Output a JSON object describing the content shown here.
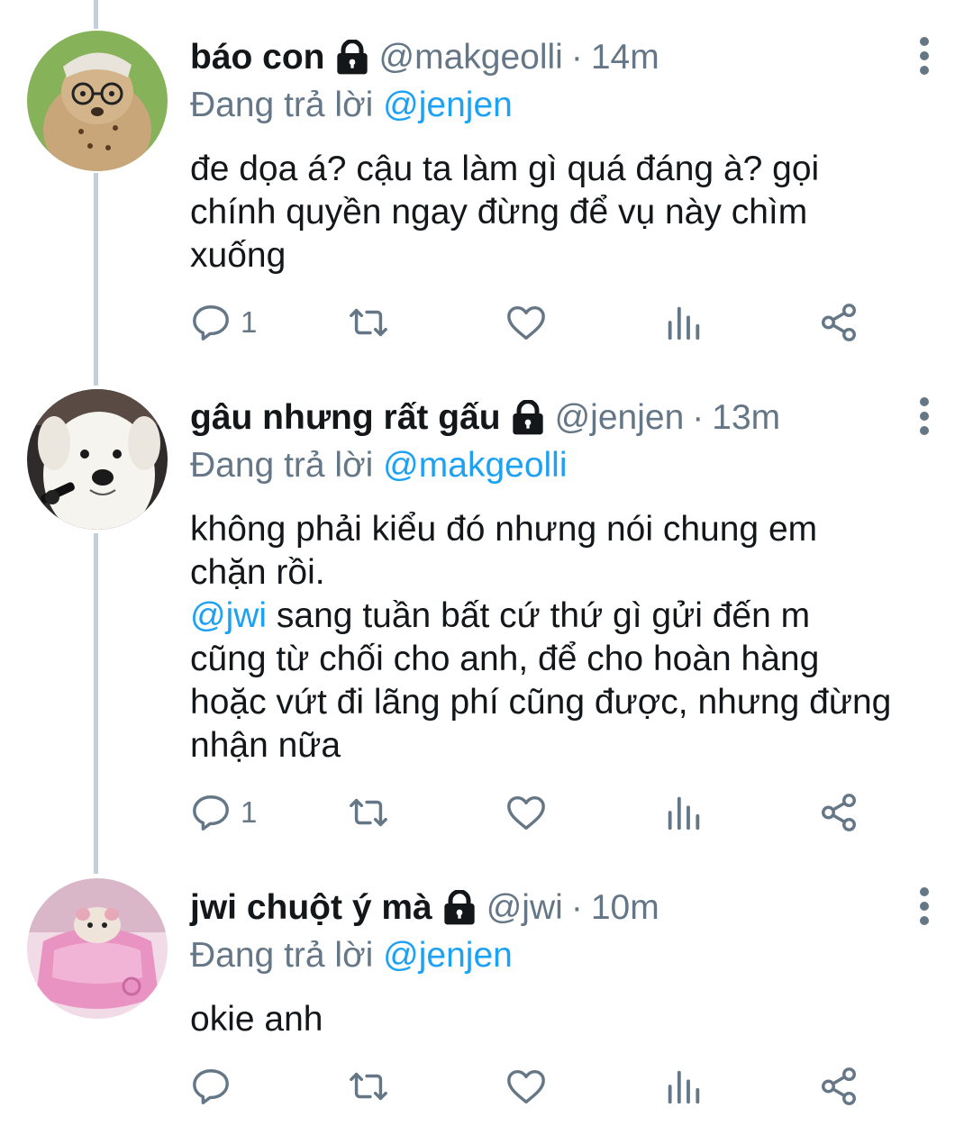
{
  "tweets": [
    {
      "display_name": "báo con",
      "handle": "@makgeolli",
      "separator": "·",
      "time": "14m",
      "replying_prefix": "Đang trả lời",
      "replying_to": "@jenjen",
      "text_lines": [
        "đe dọa á? cậu ta làm gì quá đáng à? gọi",
        "chính quyền ngay đừng để vụ này chìm",
        "xuống"
      ],
      "reply_count": "1",
      "avatar_colors": [
        "#7aa84a",
        "#c9a57a"
      ]
    },
    {
      "display_name": "gâu nhưng rất gấu",
      "handle": "@jenjen",
      "separator": "·",
      "time": "13m",
      "replying_prefix": "Đang trả lời",
      "replying_to": "@makgeolli",
      "text_line1": "không phải kiểu đó nhưng nói chung em",
      "text_line2": "chặn rồi.",
      "mention": "@jwi",
      "text_line3_rest": " sang tuần bất cứ thứ gì gửi đến m",
      "text_line4": "cũng từ chối cho anh, để cho hoàn hàng",
      "text_line5": "hoặc vứt đi lãng phí cũng được, nhưng đừng",
      "text_line6": "nhận nữa",
      "reply_count": "1",
      "avatar_colors": [
        "#3a3a3a",
        "#f4f2ee"
      ]
    },
    {
      "display_name": "jwi chuột ý mà",
      "handle": "@jwi",
      "separator": "·",
      "time": "10m",
      "replying_prefix": "Đang trả lời",
      "replying_to": "@jenjen",
      "text": "okie anh",
      "reply_count": "",
      "avatar_colors": [
        "#e9a6c8",
        "#f3d9e6"
      ]
    }
  ],
  "colors": {
    "accent": "#1da1f2",
    "secondary_text": "#657786",
    "icon": "#657786",
    "thread_line": "#c4cfd6"
  },
  "icons": {
    "reply": "reply-icon",
    "retweet": "retweet-icon",
    "like": "heart-icon",
    "analytics": "analytics-icon",
    "share": "share-icon",
    "protected": "lock-icon",
    "more": "more-vertical-icon"
  }
}
